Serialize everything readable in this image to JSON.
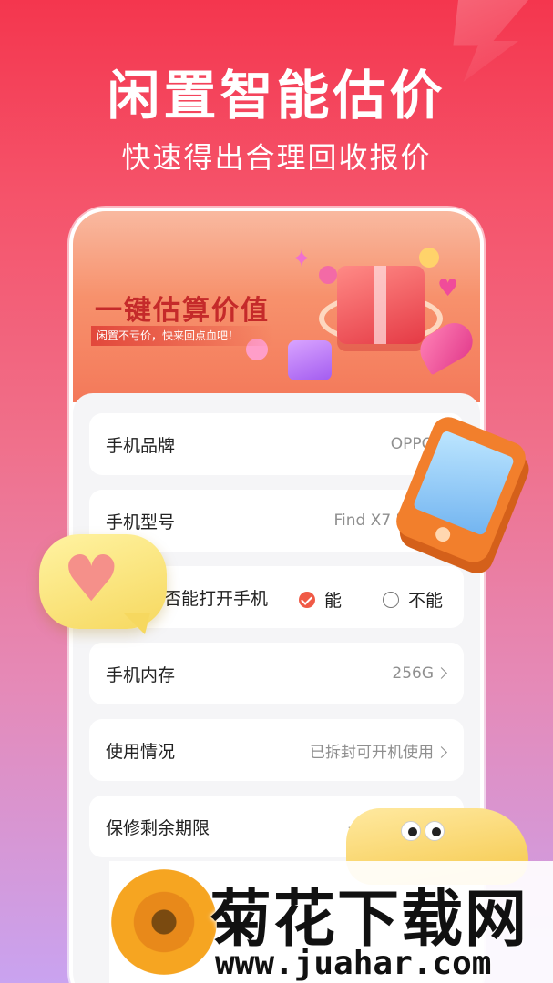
{
  "promo": {
    "headline": "闲置智能估价",
    "subhead": "快速得出合理回收报价"
  },
  "banner": {
    "title": "一键估算价值",
    "tagline": "闲置不亏价，快来回点血吧！"
  },
  "form": {
    "rows": [
      {
        "label": "手机品牌",
        "value": "OPPO"
      },
      {
        "label": "手机型号",
        "value": "Find X7 U"
      },
      {
        "label": "否能打开手机",
        "options": [
          "能",
          "不能"
        ],
        "selected": "能"
      },
      {
        "label": "手机内存",
        "value": "256G"
      },
      {
        "label": "使用情况",
        "value": "已拆封可开机使用"
      },
      {
        "label": "保修剩余期限",
        "value": "一"
      }
    ]
  },
  "stickers": {
    "phone": "phone-sticker",
    "bubble": "heart-speech-bubble",
    "duck": "duck-sticker"
  },
  "watermark": {
    "text": "菊花下载网",
    "url": "www.juahar.com"
  },
  "colors": {
    "accent": "#f05a46",
    "background_top": "#f4364e",
    "background_bottom": "#c9a3f0"
  }
}
